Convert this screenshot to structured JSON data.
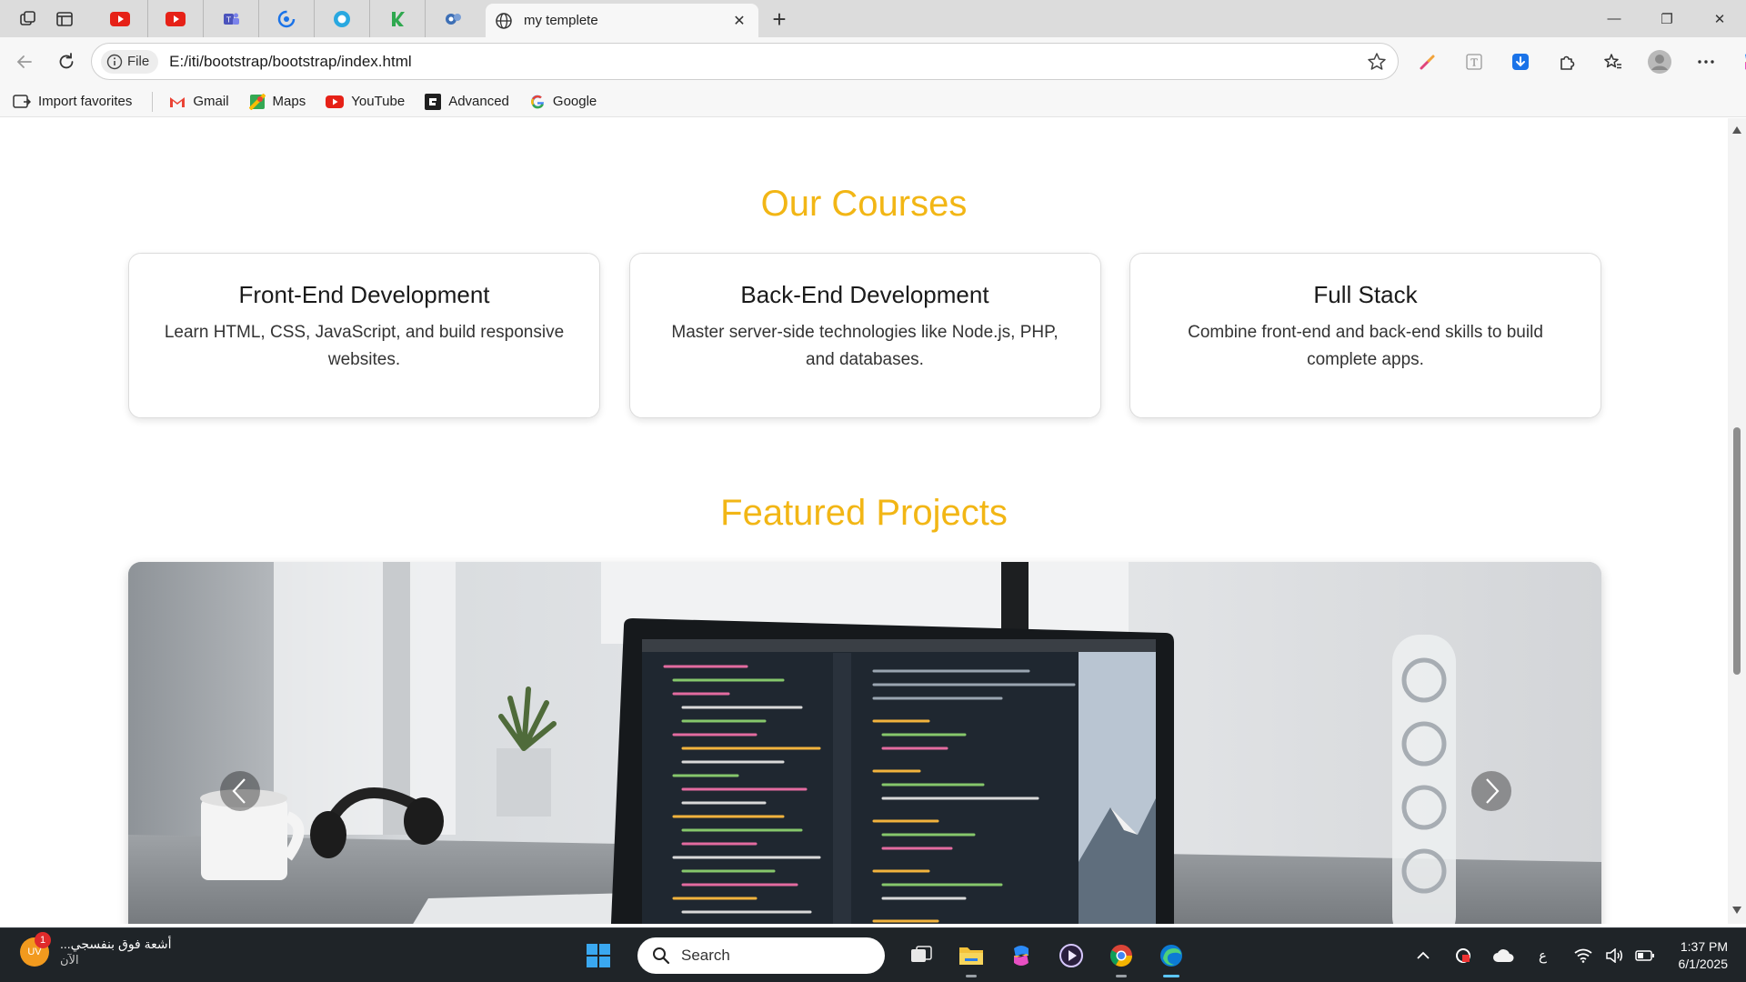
{
  "browser": {
    "active_tab_title": "my templete",
    "new_tab_label": "+",
    "close_tab_label": "✕",
    "address": {
      "scheme_label": "File",
      "url": "E:/iti/bootstrap/bootstrap/index.html"
    },
    "window_controls": {
      "minimize": "—",
      "restore": "❐",
      "close": "✕"
    },
    "favorites": [
      {
        "label": "Import favorites"
      },
      {
        "label": "Gmail"
      },
      {
        "label": "Maps"
      },
      {
        "label": "YouTube"
      },
      {
        "label": "Advanced"
      },
      {
        "label": "Google"
      }
    ]
  },
  "page": {
    "courses_title": "Our Courses",
    "courses": [
      {
        "title": "Front-End Development",
        "description": "Learn HTML, CSS, JavaScript, and build responsive websites."
      },
      {
        "title": "Back-End Development",
        "description": "Master server-side technologies like Node.js, PHP, and databases."
      },
      {
        "title": "Full Stack",
        "description": "Combine front-end and back-end skills to build complete apps."
      }
    ],
    "projects_title": "Featured Projects"
  },
  "taskbar": {
    "notification": {
      "title": "أشعة فوق بنفسجي...",
      "subtitle": "الآن",
      "badge": "1",
      "avatar_text": "UV"
    },
    "search_label": "Search",
    "input_indicator": "ع",
    "time": "1:37 PM",
    "date": "6/1/2025"
  },
  "colors": {
    "accent_heading": "#f2b615",
    "taskbar_bg": "#1f2428"
  }
}
